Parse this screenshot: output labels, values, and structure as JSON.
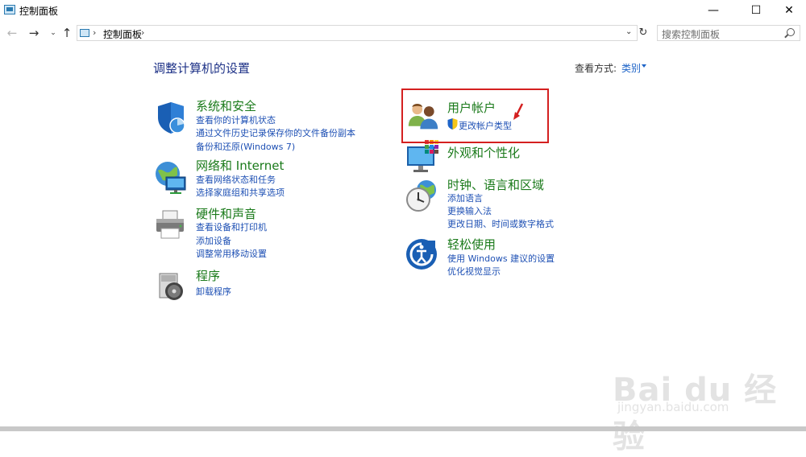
{
  "window": {
    "title": "控制面板",
    "minimize": "—",
    "maximize": "☐",
    "close": "✕"
  },
  "nav": {
    "back": "←",
    "forward": "→",
    "recent": "⌄",
    "up": "↑",
    "refresh": "↻"
  },
  "address": {
    "path": "控制面板",
    "separator": "›"
  },
  "search": {
    "placeholder": "搜索控制面板"
  },
  "page": {
    "title": "调整计算机的设置",
    "view_by_label": "查看方式:",
    "view_by_value": "类别"
  },
  "categories_left": [
    {
      "title": "系统和安全",
      "icon": "shield-icon",
      "links": [
        "查看你的计算机状态",
        "通过文件历史记录保存你的文件备份副本",
        "备份和还原(Windows 7)"
      ]
    },
    {
      "title": "网络和 Internet",
      "icon": "network-globe-icon",
      "links": [
        "查看网络状态和任务",
        "选择家庭组和共享选项"
      ]
    },
    {
      "title": "硬件和声音",
      "icon": "printer-icon",
      "links": [
        "查看设备和打印机",
        "添加设备",
        "调整常用移动设置"
      ]
    },
    {
      "title": "程序",
      "icon": "programs-disc-icon",
      "links": [
        "卸载程序"
      ]
    }
  ],
  "categories_right": [
    {
      "title": "用户帐户",
      "icon": "users-icon",
      "links": [
        "更改帐户类型"
      ]
    },
    {
      "title": "外观和个性化",
      "icon": "monitor-icon",
      "links": []
    },
    {
      "title": "时钟、语言和区域",
      "icon": "clock-globe-icon",
      "links": [
        "添加语言",
        "更换输入法",
        "更改日期、时间或数字格式"
      ]
    },
    {
      "title": "轻松使用",
      "icon": "ease-of-access-icon",
      "links": [
        "使用 Windows 建议的设置",
        "优化视觉显示"
      ]
    }
  ],
  "colors": {
    "category_title": "#1a7a1a",
    "link": "#1e50b4",
    "page_title": "#1e3287",
    "highlight": "#d42020"
  },
  "watermark": {
    "logo": "Bai du 经验",
    "url": "jingyan.baidu.com"
  }
}
